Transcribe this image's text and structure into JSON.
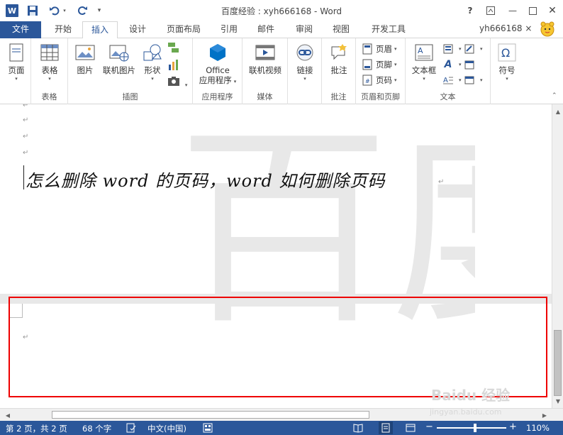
{
  "app": {
    "logo_letter": "W",
    "title": "百度经验 : xyh666168 - Word"
  },
  "window_controls": {
    "help": "?",
    "minimize": "—",
    "close": "✕"
  },
  "tabs": [
    {
      "label": "文件"
    },
    {
      "label": "开始"
    },
    {
      "label": "插入"
    },
    {
      "label": "设计"
    },
    {
      "label": "页面布局"
    },
    {
      "label": "引用"
    },
    {
      "label": "邮件"
    },
    {
      "label": "审阅"
    },
    {
      "label": "视图"
    },
    {
      "label": "开发工具"
    }
  ],
  "user": {
    "name": "yh666168 ×"
  },
  "ribbon": {
    "groups": {
      "pages": {
        "button": "页面"
      },
      "tables": {
        "button": "表格",
        "label": "表格"
      },
      "illustrations": {
        "label": "插图",
        "picture": "图片",
        "online_picture": "联机图片",
        "shapes": "形状"
      },
      "apps": {
        "label": "应用程序",
        "office": "Office",
        "office2": "应用程序"
      },
      "media": {
        "label": "媒体",
        "online_video": "联机视频"
      },
      "links": {
        "button": "链接"
      },
      "comments": {
        "label": "批注",
        "button": "批注"
      },
      "header_footer": {
        "label": "页眉和页脚",
        "header": "页眉",
        "footer": "页脚",
        "page_number": "页码"
      },
      "text": {
        "label": "文本",
        "textbox": "文本框"
      },
      "symbols": {
        "button": "符号"
      }
    }
  },
  "document": {
    "heading": "怎么删除 word 的页码，word 如何删除页码",
    "para_mark": "↵",
    "watermark": "百度"
  },
  "statusbar": {
    "page": "第 2 页，共 2 页",
    "words": "68 个字",
    "language": "中文(中国)",
    "zoom": "110%",
    "zoom_level": 0.55
  },
  "baidu_watermark": {
    "brand": "Baidu 经验",
    "url": "jingyan.baidu.com"
  },
  "colors": {
    "accent": "#2b579a",
    "highlight": "#e00000"
  }
}
